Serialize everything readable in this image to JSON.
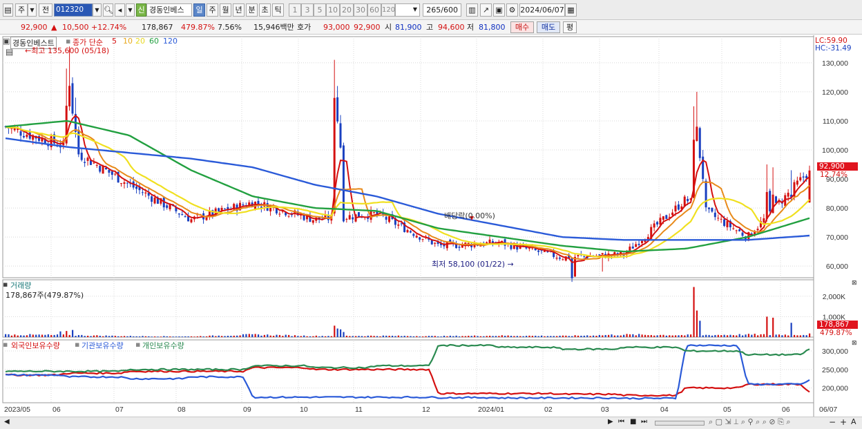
{
  "toolbar": {
    "market_tabs": [
      "주",
      "전"
    ],
    "code": "012320",
    "name_badge": "신",
    "name": "경동인베스",
    "period_tabs": [
      "일",
      "주",
      "월",
      "년",
      "분",
      "초",
      "틱"
    ],
    "active_period": "일",
    "interval_tabs": [
      "1",
      "3",
      "5",
      "10",
      "20",
      "30",
      "60",
      "120"
    ],
    "count": "265",
    "count_total": "/600",
    "date": "2024/06/07"
  },
  "quote": {
    "price": "92,900",
    "change": "10,500",
    "change_pct": "+12.74%",
    "volume": "178,867",
    "volume_pct": "479.87%",
    "turnover": "7.56%",
    "amount": "15,946백만",
    "ask_label": "호가",
    "ask": "93,000",
    "bid": "92,900",
    "open_label": "시",
    "open": "81,900",
    "high_label": "고",
    "high": "94,600",
    "low_label": "저",
    "low": "81,800",
    "buy_btn": "매수",
    "sell_btn": "매도",
    "eval_btn": "평"
  },
  "price_panel": {
    "title": "경동인베스트",
    "ma_label": "종가 단순",
    "ma_periods": [
      "5",
      "10",
      "20",
      "60",
      "120"
    ],
    "ma_colors": [
      "#d41010",
      "#e88a1a",
      "#f0e020",
      "#22a040",
      "#2a5ad8"
    ],
    "high_note": "최고 135,600 (05/18)",
    "low_note": "최저 58,100 (01/22)",
    "dividend_note": "배당락(0.00%)",
    "lc": "LC:59.90",
    "hc": "HC:-31.49",
    "current_price_tag": "92,900",
    "current_pct_tag": "12.74%",
    "y_ticks": [
      "130,000",
      "120,000",
      "110,000",
      "100,000",
      "90,000",
      "80,000",
      "70,000",
      "60,000"
    ]
  },
  "volume_panel": {
    "title": "거래량",
    "value": "178,867주(479.87%)",
    "y_ticks": [
      "2,000K",
      "1,000K"
    ],
    "tag_value": "178,867",
    "tag_pct": "479.87%"
  },
  "holdings_panel": {
    "series_labels": [
      "외국인보유수량",
      "기관보유수량",
      "개인보유수량"
    ],
    "series_colors": [
      "#d41010",
      "#2a5ad8",
      "#2a8a50"
    ],
    "y_ticks": [
      "300,000",
      "250,000",
      "200,000"
    ]
  },
  "x_axis": [
    "2023/05",
    "06",
    "07",
    "08",
    "09",
    "10",
    "11",
    "12",
    "2024/01",
    "02",
    "03",
    "04",
    "05",
    "06",
    "06/07"
  ],
  "chart_data": {
    "type": "candlestick",
    "title": "경동인베스트",
    "x": [
      "2023/05",
      "06",
      "07",
      "08",
      "09",
      "10",
      "11",
      "12",
      "2024/01",
      "02",
      "03",
      "04",
      "05",
      "06"
    ],
    "close_approx": [
      108000,
      101000,
      88000,
      76000,
      82000,
      76000,
      78000,
      67000,
      68000,
      63000,
      64000,
      83000,
      70000,
      92900
    ],
    "ma5_approx": [
      110000,
      100000,
      87000,
      76000,
      80000,
      75000,
      77000,
      67000,
      67000,
      63000,
      64000,
      84000,
      71000,
      86000
    ],
    "ma20_approx": [
      108000,
      103000,
      90000,
      79000,
      84000,
      77000,
      78000,
      69000,
      67000,
      64000,
      65000,
      85000,
      72000,
      80000
    ],
    "ma60_approx": [
      108000,
      110000,
      105000,
      93000,
      84000,
      80000,
      79000,
      73000,
      70000,
      67000,
      65000,
      66000,
      70000,
      76500
    ],
    "ma120_approx": [
      104000,
      101000,
      99000,
      97000,
      94000,
      88000,
      84000,
      78000,
      74000,
      70000,
      69000,
      69000,
      69000,
      70500
    ],
    "y_ticks": [
      130000,
      120000,
      110000,
      100000,
      90000,
      80000,
      70000,
      60000
    ],
    "ylim": [
      56000,
      139000
    ],
    "volume_approx_k": [
      280,
      120,
      60,
      40,
      560,
      70,
      80,
      60,
      90,
      70,
      2450,
      120,
      1000,
      179
    ],
    "holdings_foreign_approx": [
      235000,
      240000,
      245000,
      245000,
      255000,
      250000,
      250000,
      185000,
      185000,
      183000,
      180000,
      200000,
      210000,
      190000
    ],
    "holdings_inst_approx": [
      235000,
      230000,
      225000,
      230000,
      175000,
      175000,
      175000,
      174000,
      173000,
      173000,
      172000,
      315000,
      210000,
      220000
    ],
    "holdings_indiv_approx": [
      245000,
      245000,
      250000,
      250000,
      260000,
      255000,
      260000,
      315000,
      310000,
      305000,
      310000,
      300000,
      290000,
      305000
    ]
  }
}
